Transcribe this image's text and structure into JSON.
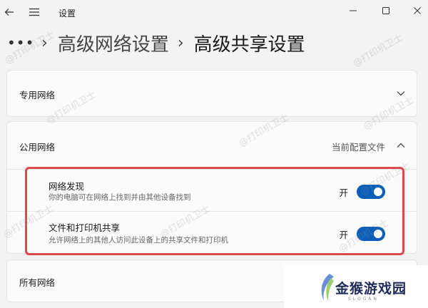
{
  "window": {
    "title": "设置"
  },
  "breadcrumb": {
    "overflow": "•••",
    "parent": "高级网络设置",
    "current": "高级共享设置"
  },
  "sections": {
    "private": {
      "label": "专用网络"
    },
    "public": {
      "label": "公用网络",
      "profile_tag": "当前配置文件",
      "settings": [
        {
          "title": "网络发现",
          "description": "你的电脑可在网络上找到并由其他设备找到",
          "state": "开",
          "on": true
        },
        {
          "title": "文件和打印机共享",
          "description": "允许网络上的其他人访问此设备上的共享文件和打印机",
          "state": "开",
          "on": true
        }
      ]
    },
    "all": {
      "label": "所有网络"
    }
  },
  "watermark_text": "@打印机卫士",
  "logo": {
    "text": "金猴游戏园",
    "sub": "SLOGAN"
  },
  "colors": {
    "toggle_on": "#0c5fb8",
    "highlight": "#e0474c"
  },
  "icons": {
    "back": "back-arrow-icon",
    "menu": "hamburger-menu-icon",
    "minimize": "minimize-icon",
    "maximize": "maximize-icon",
    "close": "close-icon",
    "chevron_down": "chevron-down-icon",
    "chevron_up": "chevron-up-icon"
  }
}
